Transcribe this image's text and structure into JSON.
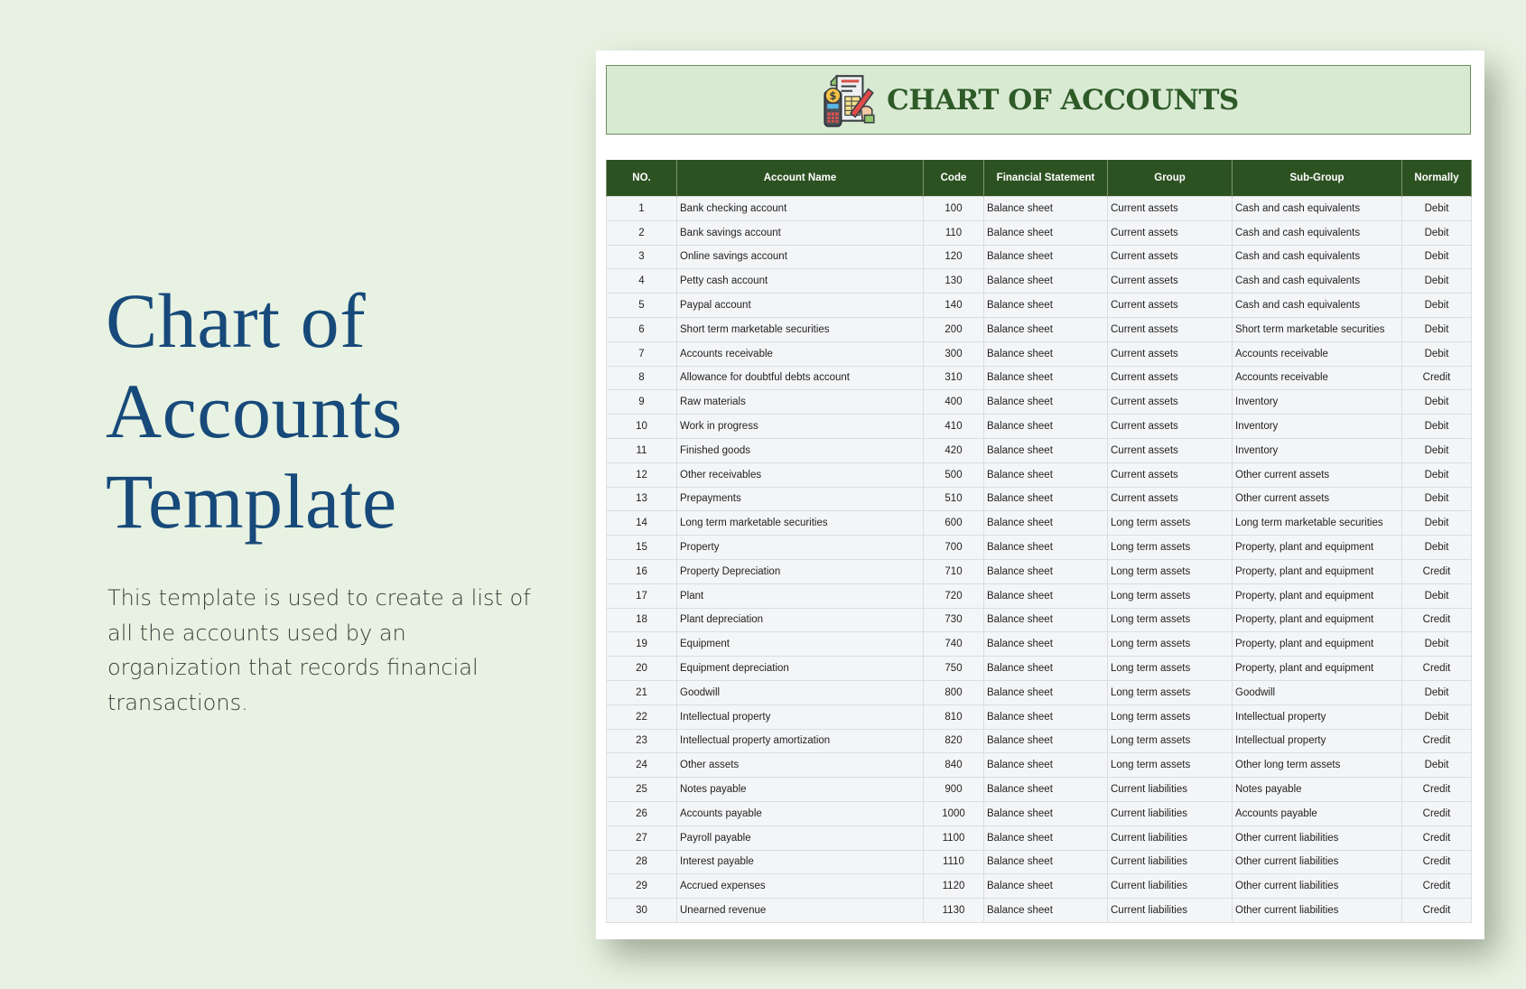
{
  "hero": {
    "title_lines": [
      "Chart of",
      "Accounts",
      "Template"
    ],
    "description": "This template is used to create a list of all the accounts used by an organization that records financial transactions."
  },
  "sheet": {
    "title": "CHART OF ACCOUNTS",
    "icon": "accounting-calculator-document-icon",
    "colors": {
      "header_bg": "#2d5222",
      "title_bg": "#d9ead3",
      "title_text": "#2e5a28",
      "hero_title": "#174a7a",
      "page_bg": "#e8f2e2"
    },
    "columns": [
      "NO.",
      "Account Name",
      "Code",
      "Financial Statement",
      "Group",
      "Sub-Group",
      "Normally"
    ],
    "rows": [
      {
        "no": "1",
        "name": "Bank checking account",
        "code": "100",
        "statement": "Balance sheet",
        "group": "Current assets",
        "subgroup": "Cash and cash equivalents",
        "normally": "Debit"
      },
      {
        "no": "2",
        "name": "Bank savings account",
        "code": "110",
        "statement": "Balance sheet",
        "group": "Current assets",
        "subgroup": "Cash and cash equivalents",
        "normally": "Debit"
      },
      {
        "no": "3",
        "name": "Online savings account",
        "code": "120",
        "statement": "Balance sheet",
        "group": "Current assets",
        "subgroup": "Cash and cash equivalents",
        "normally": "Debit"
      },
      {
        "no": "4",
        "name": "Petty cash account",
        "code": "130",
        "statement": "Balance sheet",
        "group": "Current assets",
        "subgroup": "Cash and cash equivalents",
        "normally": "Debit"
      },
      {
        "no": "5",
        "name": "Paypal account",
        "code": "140",
        "statement": "Balance sheet",
        "group": "Current assets",
        "subgroup": "Cash and cash equivalents",
        "normally": "Debit"
      },
      {
        "no": "6",
        "name": "Short term marketable securities",
        "code": "200",
        "statement": "Balance sheet",
        "group": "Current assets",
        "subgroup": "Short term marketable securities",
        "normally": "Debit"
      },
      {
        "no": "7",
        "name": "Accounts receivable",
        "code": "300",
        "statement": "Balance sheet",
        "group": "Current assets",
        "subgroup": "Accounts receivable",
        "normally": "Debit"
      },
      {
        "no": "8",
        "name": "Allowance for doubtful debts account",
        "code": "310",
        "statement": "Balance sheet",
        "group": "Current assets",
        "subgroup": "Accounts receivable",
        "normally": "Credit"
      },
      {
        "no": "9",
        "name": "Raw materials",
        "code": "400",
        "statement": "Balance sheet",
        "group": "Current assets",
        "subgroup": "Inventory",
        "normally": "Debit"
      },
      {
        "no": "10",
        "name": "Work in progress",
        "code": "410",
        "statement": "Balance sheet",
        "group": "Current assets",
        "subgroup": "Inventory",
        "normally": "Debit"
      },
      {
        "no": "11",
        "name": "Finished goods",
        "code": "420",
        "statement": "Balance sheet",
        "group": "Current assets",
        "subgroup": "Inventory",
        "normally": "Debit"
      },
      {
        "no": "12",
        "name": "Other receivables",
        "code": "500",
        "statement": "Balance sheet",
        "group": "Current assets",
        "subgroup": "Other current assets",
        "normally": "Debit"
      },
      {
        "no": "13",
        "name": "Prepayments",
        "code": "510",
        "statement": "Balance sheet",
        "group": "Current assets",
        "subgroup": "Other current assets",
        "normally": "Debit"
      },
      {
        "no": "14",
        "name": "Long term marketable securities",
        "code": "600",
        "statement": "Balance sheet",
        "group": "Long term assets",
        "subgroup": "Long term marketable securities",
        "normally": "Debit"
      },
      {
        "no": "15",
        "name": "Property",
        "code": "700",
        "statement": "Balance sheet",
        "group": "Long term assets",
        "subgroup": "Property, plant and equipment",
        "normally": "Debit"
      },
      {
        "no": "16",
        "name": "Property Depreciation",
        "code": "710",
        "statement": "Balance sheet",
        "group": "Long term assets",
        "subgroup": "Property, plant and equipment",
        "normally": "Credit"
      },
      {
        "no": "17",
        "name": "Plant",
        "code": "720",
        "statement": "Balance sheet",
        "group": "Long term assets",
        "subgroup": "Property, plant and equipment",
        "normally": "Debit"
      },
      {
        "no": "18",
        "name": "Plant depreciation",
        "code": "730",
        "statement": "Balance sheet",
        "group": "Long term assets",
        "subgroup": "Property, plant and equipment",
        "normally": "Credit"
      },
      {
        "no": "19",
        "name": "Equipment",
        "code": "740",
        "statement": "Balance sheet",
        "group": "Long term assets",
        "subgroup": "Property, plant and equipment",
        "normally": "Debit"
      },
      {
        "no": "20",
        "name": "Equipment depreciation",
        "code": "750",
        "statement": "Balance sheet",
        "group": "Long term assets",
        "subgroup": "Property, plant and equipment",
        "normally": "Credit"
      },
      {
        "no": "21",
        "name": "Goodwill",
        "code": "800",
        "statement": "Balance sheet",
        "group": "Long term assets",
        "subgroup": "Goodwill",
        "normally": "Debit"
      },
      {
        "no": "22",
        "name": "Intellectual property",
        "code": "810",
        "statement": "Balance sheet",
        "group": "Long term assets",
        "subgroup": "Intellectual property",
        "normally": "Debit"
      },
      {
        "no": "23",
        "name": "Intellectual property amortization",
        "code": "820",
        "statement": "Balance sheet",
        "group": "Long term assets",
        "subgroup": "Intellectual property",
        "normally": "Credit"
      },
      {
        "no": "24",
        "name": "Other assets",
        "code": "840",
        "statement": "Balance sheet",
        "group": "Long term assets",
        "subgroup": "Other long term assets",
        "normally": "Debit"
      },
      {
        "no": "25",
        "name": "Notes payable",
        "code": "900",
        "statement": "Balance sheet",
        "group": "Current liabilities",
        "subgroup": "Notes payable",
        "normally": "Credit"
      },
      {
        "no": "26",
        "name": "Accounts payable",
        "code": "1000",
        "statement": "Balance sheet",
        "group": "Current liabilities",
        "subgroup": "Accounts payable",
        "normally": "Credit"
      },
      {
        "no": "27",
        "name": "Payroll payable",
        "code": "1100",
        "statement": "Balance sheet",
        "group": "Current liabilities",
        "subgroup": "Other current liabilities",
        "normally": "Credit"
      },
      {
        "no": "28",
        "name": "Interest payable",
        "code": "1110",
        "statement": "Balance sheet",
        "group": "Current liabilities",
        "subgroup": "Other current liabilities",
        "normally": "Credit"
      },
      {
        "no": "29",
        "name": "Accrued expenses",
        "code": "1120",
        "statement": "Balance sheet",
        "group": "Current liabilities",
        "subgroup": "Other current liabilities",
        "normally": "Credit"
      },
      {
        "no": "30",
        "name": "Unearned revenue",
        "code": "1130",
        "statement": "Balance sheet",
        "group": "Current liabilities",
        "subgroup": "Other current liabilities",
        "normally": "Credit"
      }
    ]
  }
}
